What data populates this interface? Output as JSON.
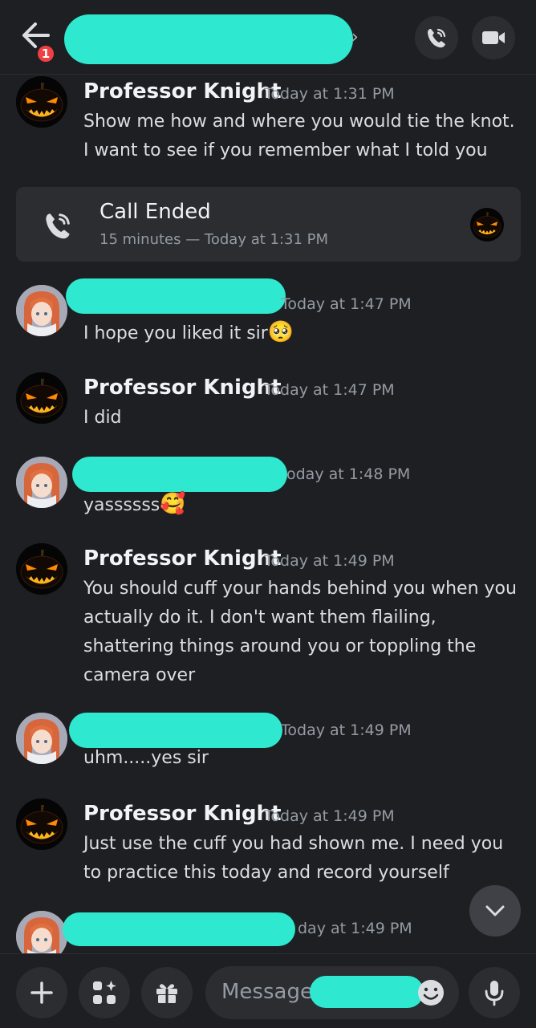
{
  "header": {
    "notification_count": "1"
  },
  "messages": [
    {
      "author": "Professor Knight",
      "time": "Today at 1:31 PM",
      "text": "Show me how and where you would tie the knot. I want to see if you remember what I told you"
    },
    {
      "author": "",
      "time": "Today at 1:47 PM",
      "text": "I hope you liked it sir",
      "emoji": "🥺"
    },
    {
      "author": "Professor Knight",
      "time": "Today at 1:47 PM",
      "text": "I did"
    },
    {
      "author": "",
      "time": "oday at 1:48 PM",
      "text": "yassssss",
      "emoji": "🥰"
    },
    {
      "author": "Professor Knight",
      "time": "Today at 1:49 PM",
      "text": "You should cuff your hands behind you when you actually do it. I don't want them flailing, shattering things around you or toppling the camera over"
    },
    {
      "author": "",
      "time": "Today at 1:49 PM",
      "text": "uhm.....yes sir"
    },
    {
      "author": "Professor Knight",
      "time": "Today at 1:49 PM",
      "text": "Just use the cuff you had shown me. I need you to practice this today and record yourself"
    },
    {
      "author": "",
      "time": "day at 1:49 PM",
      "text": ""
    }
  ],
  "call": {
    "title": "Call Ended",
    "subtitle": "15 minutes — Today at 1:31 PM"
  },
  "composer": {
    "placeholder": "Message @"
  },
  "icons": {
    "back": "arrow-left-icon",
    "voice_call": "phone-call-icon",
    "video_call": "video-camera-icon",
    "add": "plus-icon",
    "apps": "apps-sparkle-icon",
    "gift": "gift-icon",
    "emoji": "smiley-icon",
    "mic": "microphone-icon",
    "scroll_down": "chevron-down-icon"
  },
  "colors": {
    "background": "#1e1f22",
    "card": "#2b2d31",
    "badge": "#f23f43",
    "redaction": "#2ee8cf",
    "muted": "#949ba4"
  }
}
